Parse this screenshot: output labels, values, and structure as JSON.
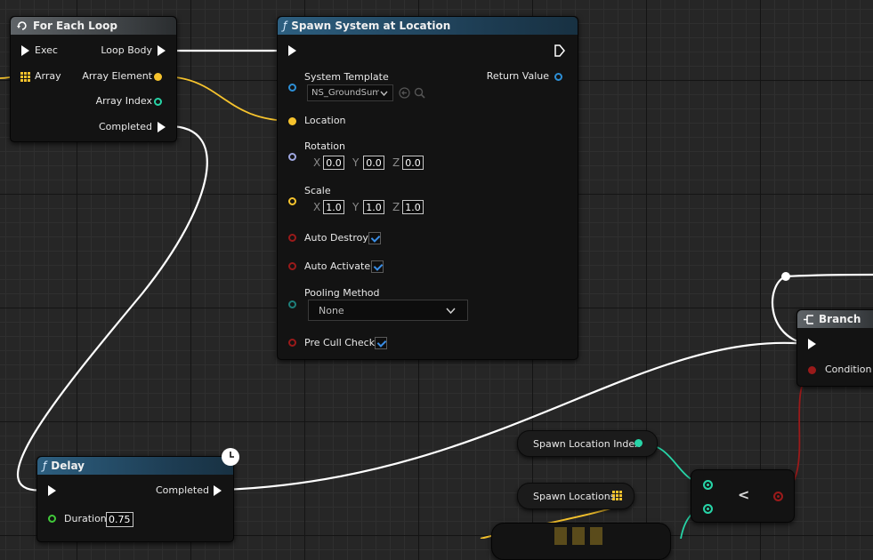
{
  "for_each_loop": {
    "title": "For Each Loop",
    "exec_label": "Exec",
    "array_label": "Array",
    "loop_body_label": "Loop Body",
    "array_element_label": "Array Element",
    "array_index_label": "Array Index",
    "completed_label": "Completed"
  },
  "spawn_system": {
    "title": "Spawn System at Location",
    "system_template_label": "System Template",
    "system_template_value": "NS_GroundSum",
    "return_value_label": "Return Value",
    "location_label": "Location",
    "rotation_label": "Rotation",
    "rotation": {
      "x": "0.0",
      "y": "0.0",
      "z": "0.0"
    },
    "scale_label": "Scale",
    "scale": {
      "x": "1.0",
      "y": "1.0",
      "z": "1.0"
    },
    "axis_x": "X",
    "axis_y": "Y",
    "axis_z": "Z",
    "auto_destroy_label": "Auto Destroy",
    "auto_destroy": true,
    "auto_activate_label": "Auto Activate",
    "auto_activate": true,
    "pooling_method_label": "Pooling Method",
    "pooling_method_value": "None",
    "pre_cull_check_label": "Pre Cull Check",
    "pre_cull_check": true
  },
  "branch": {
    "title": "Branch",
    "condition_label": "Condition"
  },
  "delay": {
    "title": "Delay",
    "completed_label": "Completed",
    "duration_label": "Duration",
    "duration_value": "0.75"
  },
  "spawn_location_index": {
    "label": "Spawn Location Index"
  },
  "spawn_locations": {
    "label": "Spawn Locations"
  },
  "less_than": {
    "symbol": "<"
  },
  "colors": {
    "exec_wire": "#ffffff",
    "vector_wire": "#f6c32d",
    "int_wire": "#27d4a7",
    "bool_wire": "#9a1a1a",
    "node_header_function": "#1d3c52",
    "node_header_macro": "#3c4043"
  },
  "icons": {
    "loop": "loop-icon",
    "function": "function-icon",
    "branch": "branch-icon",
    "clock": "clock-icon",
    "search": "search-icon",
    "use": "use-selected-icon",
    "dropdown": "chevron-down-icon",
    "array_grid": "array-grid-icon"
  }
}
